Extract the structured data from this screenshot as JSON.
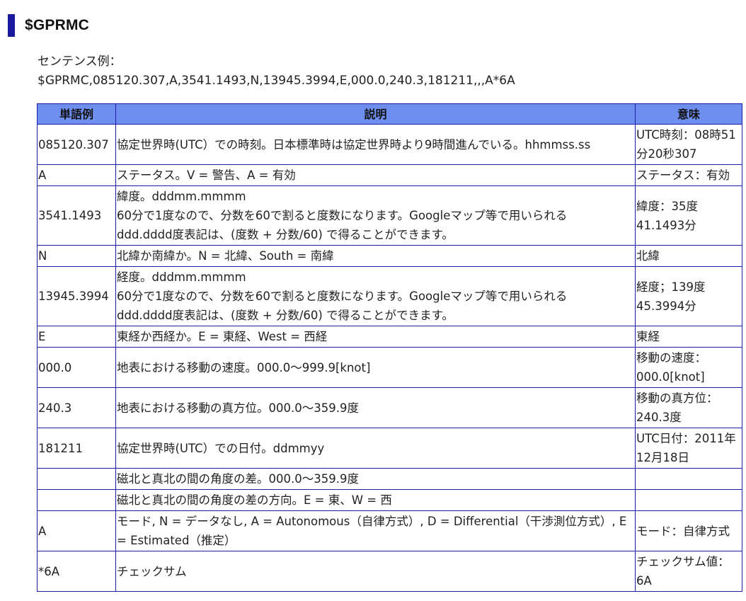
{
  "heading": "$GPRMC",
  "example_label": "センテンス例：",
  "example_sentence": "$GPRMC,085120.307,A,3541.1493,N,13945.3994,E,000.0,240.3,181211,,,A*6A",
  "table": {
    "headers": [
      "単語例",
      "説明",
      "意味"
    ],
    "rows": [
      {
        "word": "085120.307",
        "desc": "協定世界時(UTC）での時刻。日本標準時は協定世界時より9時間進んでいる。hhmmss.ss",
        "meaning": "UTC時刻：08時51分20秒307"
      },
      {
        "word": "A",
        "desc": "ステータス。V = 警告、A = 有効",
        "meaning": "ステータス：有効"
      },
      {
        "word": "3541.1493",
        "desc": "緯度。dddmm.mmmm\n60分で1度なので、分数を60で割ると度数になります。Googleマップ等で用いられる\nddd.dddd度表記は、(度数 + 分数/60) で得ることができます。",
        "meaning": "緯度：35度41.1493分"
      },
      {
        "word": "N",
        "desc": "北緯か南緯か。N = 北緯、South = 南緯",
        "meaning": "北緯"
      },
      {
        "word": "13945.3994",
        "desc": "経度。dddmm.mmmm\n60分で1度なので、分数を60で割ると度数になります。Googleマップ等で用いられる\nddd.dddd度表記は、(度数 + 分数/60) で得ることができます。",
        "meaning": "経度；139度45.3994分"
      },
      {
        "word": "E",
        "desc": "東経か西経か。E = 東経、West = 西経",
        "meaning": "東経"
      },
      {
        "word": "000.0",
        "desc": "地表における移動の速度。000.0～999.9[knot]",
        "meaning": "移動の速度：000.0[knot]"
      },
      {
        "word": "240.3",
        "desc": "地表における移動の真方位。000.0～359.9度",
        "meaning": "移動の真方位：240.3度"
      },
      {
        "word": "181211",
        "desc": "協定世界時(UTC）での日付。ddmmyy",
        "meaning": "UTC日付：2011年12月18日"
      },
      {
        "word": "",
        "desc": "磁北と真北の間の角度の差。000.0～359.9度",
        "meaning": ""
      },
      {
        "word": "",
        "desc": "磁北と真北の間の角度の差の方向。E = 東、W = 西",
        "meaning": ""
      },
      {
        "word": "A",
        "desc": "モード, N = データなし, A = Autonomous（自律方式）, D = Differential（干渉測位方式）, E = Estimated（推定）",
        "meaning": "モード：自律方式"
      },
      {
        "word": "*6A",
        "desc": "チェックサム",
        "meaning": "チェックサム値：6A"
      }
    ]
  }
}
